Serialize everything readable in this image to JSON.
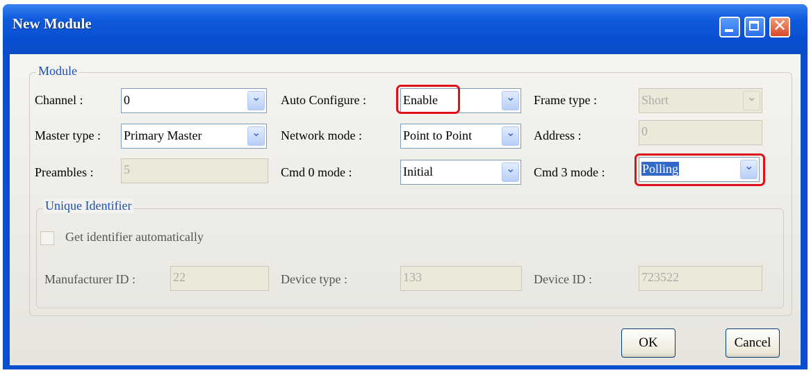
{
  "window": {
    "title": "New Module"
  },
  "module_group": {
    "label": "Module",
    "channel": {
      "label": "Channel :",
      "value": "0"
    },
    "auto_configure": {
      "label": "Auto Configure :",
      "value": "Enable"
    },
    "frame_type": {
      "label": "Frame type :",
      "value": "Short"
    },
    "master_type": {
      "label": "Master type :",
      "value": "Primary Master"
    },
    "network_mode": {
      "label": "Network mode :",
      "value": "Point to Point"
    },
    "address": {
      "label": "Address :",
      "value": "0"
    },
    "preambles": {
      "label": "Preambles :",
      "value": "5"
    },
    "cmd0_mode": {
      "label": "Cmd 0 mode :",
      "value": "Initial"
    },
    "cmd3_mode": {
      "label": "Cmd 3 mode :",
      "value": "Polling"
    }
  },
  "unique_identifier_group": {
    "label": "Unique Identifier",
    "get_identifier": {
      "label": "Get identifier automatically",
      "checked": false
    },
    "manufacturer_id": {
      "label": "Manufacturer ID :",
      "value": "22"
    },
    "device_type": {
      "label": "Device type :",
      "value": "133"
    },
    "device_id": {
      "label": "Device ID :",
      "value": "723522"
    }
  },
  "buttons": {
    "ok": "OK",
    "cancel": "Cancel"
  },
  "colors": {
    "titlebar": "#0a4fd2",
    "highlight": "#e0101a",
    "selection": "#3168c9",
    "group_label": "#1a4fb8"
  },
  "icons": {
    "dropdown": "chevron-down-icon",
    "minimize": "minimize-icon",
    "maximize": "maximize-icon",
    "close": "close-icon"
  }
}
